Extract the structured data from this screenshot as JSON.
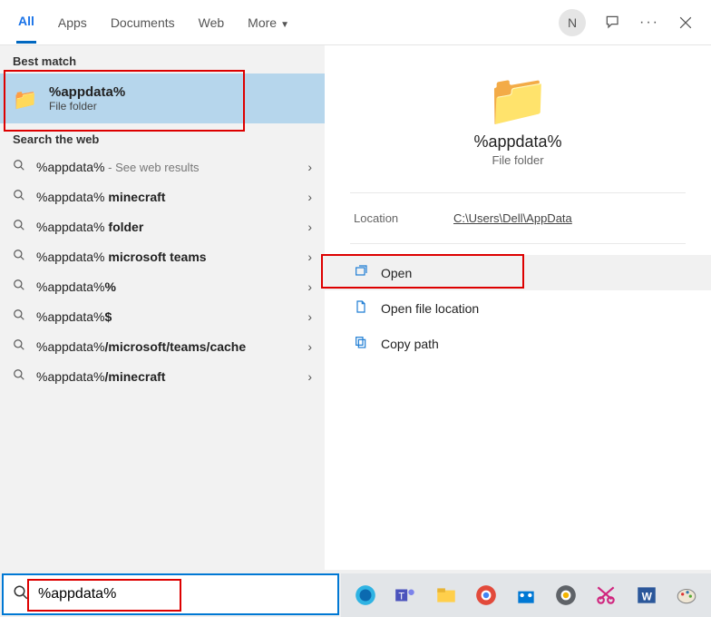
{
  "tabs": {
    "items": [
      {
        "label": "All",
        "active": true
      },
      {
        "label": "Apps"
      },
      {
        "label": "Documents"
      },
      {
        "label": "Web"
      },
      {
        "label": "More",
        "dropdown": true
      }
    ]
  },
  "avatar_initial": "N",
  "left": {
    "best_match_header": "Best match",
    "best_match": {
      "title": "%appdata%",
      "subtitle": "File folder"
    },
    "web_header": "Search the web",
    "suggestions": [
      {
        "query": "%appdata%",
        "suffix": "",
        "hint": " - See web results"
      },
      {
        "query": "%appdata%",
        "suffix": " minecraft"
      },
      {
        "query": "%appdata%",
        "suffix": " folder"
      },
      {
        "query": "%appdata%",
        "suffix": " microsoft teams"
      },
      {
        "query": "%appdata%",
        "suffix": "%"
      },
      {
        "query": "%appdata%",
        "suffix": "$"
      },
      {
        "query": "%appdata%",
        "suffix": "/microsoft/teams/cache"
      },
      {
        "query": "%appdata%",
        "suffix": "/minecraft"
      }
    ]
  },
  "preview": {
    "title": "%appdata%",
    "subtitle": "File folder",
    "location_label": "Location",
    "location_value": "C:\\Users\\Dell\\AppData"
  },
  "actions": {
    "open": "Open",
    "open_loc": "Open file location",
    "copy_path": "Copy path"
  },
  "search_value": "%appdata%"
}
